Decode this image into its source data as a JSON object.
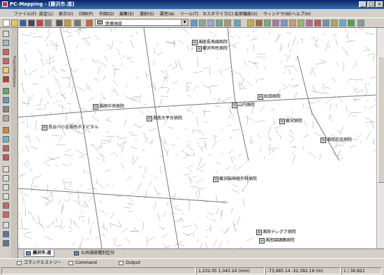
{
  "window": {
    "title": "PC-Mapping - [藤沢市.道]"
  },
  "menu": [
    "ファイル(F)",
    "設定(L)",
    "表示(V)",
    "印刷(P)",
    "作図(D)",
    "編集(E)",
    "選択(S)",
    "属性(A)",
    "ツール(T)",
    "カスタマイズ(C)",
    "拡張機能(X)",
    "ウィンドウ(W)",
    "ヘルプ(H)"
  ],
  "toolbar": {
    "layer_select": "医療施設"
  },
  "workspace_label": "ProjectWorkSpace",
  "map_labels": [
    {
      "text": "湘南長寿園病院"
    },
    {
      "text": "藤沢市民病院"
    },
    {
      "text": "山内病院"
    },
    {
      "text": "松田病院"
    },
    {
      "text": "湘南中央病院"
    },
    {
      "text": "湘南大平台病院"
    },
    {
      "text": "長谷川小金湘南ホスピタル"
    },
    {
      "text": "藤沢病院"
    },
    {
      "text": "湘南記念病院"
    },
    {
      "text": "藤沢脳神経外科病院"
    },
    {
      "text": "湘南テレグア病院"
    },
    {
      "text": "湘南園鵠鶴病院"
    }
  ],
  "tabs": [
    {
      "label": "藤沢市.道",
      "active": true
    },
    {
      "label": "公共施設種別区分",
      "active": false
    }
  ],
  "bottom_panels": [
    "コマンドヒストリー",
    "Command",
    "Output"
  ],
  "status": {
    "coords_mm": "1,232.05  1,045.24  (mm)",
    "coords_map": "-73,985.14  -32,392.19  (m)",
    "count": "1 / 36,821"
  }
}
